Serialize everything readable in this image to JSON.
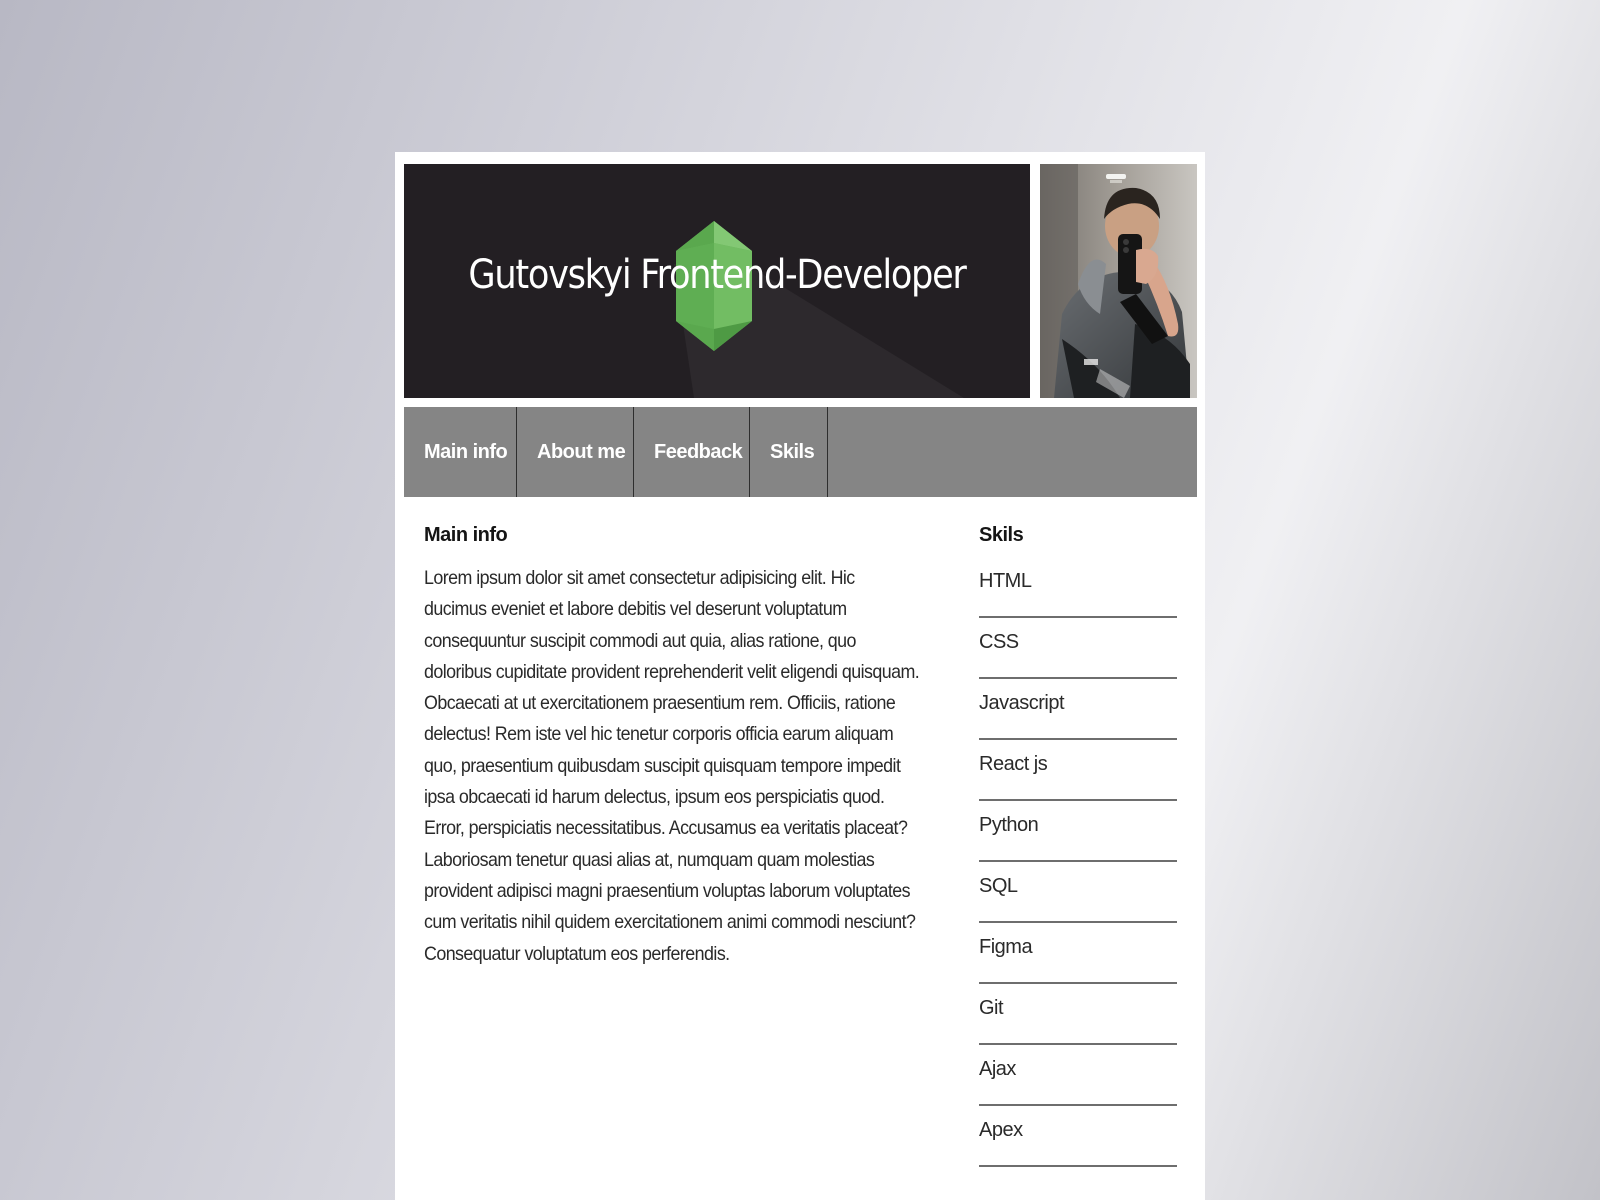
{
  "header": {
    "title": "Gutovskyi Frontend-Developer"
  },
  "nav": {
    "items": [
      {
        "label": "Main info"
      },
      {
        "label": "About me"
      },
      {
        "label": "Feedback"
      },
      {
        "label": "Skils"
      }
    ]
  },
  "main": {
    "heading": "Main info",
    "text": "Lorem ipsum dolor sit amet consectetur adipisicing elit. Hic ducimus eveniet et labore debitis vel deserunt voluptatum consequuntur suscipit commodi aut quia, alias ratione, quo doloribus cupiditate provident reprehenderit velit eligendi quisquam. Obcaecati at ut exercitationem praesentium rem. Officiis, ratione delectus! Rem iste vel hic tenetur corporis officia earum aliquam quo, praesentium quibusdam suscipit quisquam tempore impedit ipsa obcaecati id harum delectus, ipsum eos perspiciatis quod. Error, perspiciatis necessitatibus. Accusamus ea veritatis placeat? Laboriosam tenetur quasi alias at, numquam quam molestias provident adipisci magni praesentium voluptas laborum voluptates cum veritatis nihil quidem exercitationem animi commodi nesciunt? Consequatur voluptatum eos perferendis."
  },
  "skills": {
    "heading": "Skils",
    "items": [
      "HTML",
      "CSS",
      "Javascript",
      "React js",
      "Python",
      "SQL",
      "Figma",
      "Git",
      "Ajax",
      "Apex"
    ]
  },
  "colors": {
    "banner_bg": "#231f23",
    "logo_green": "#5cb85c",
    "nav_bg": "#858585"
  },
  "icons": {
    "banner_logo": "green-hexagon-gem-icon"
  }
}
